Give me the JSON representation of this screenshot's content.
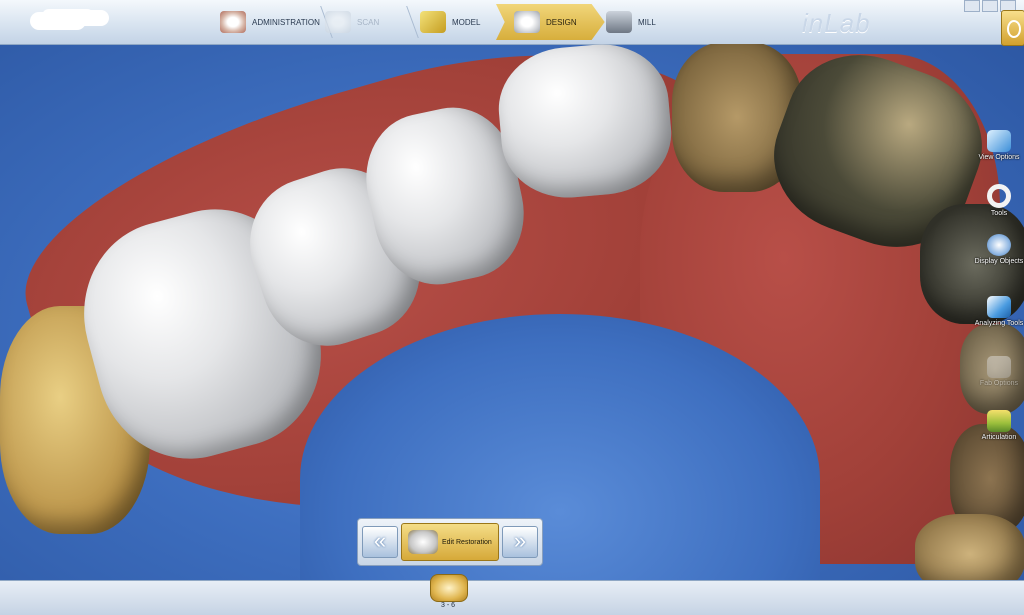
{
  "app": {
    "brand": "inLab"
  },
  "workflow": {
    "steps": [
      {
        "label": "ADMINISTRATION",
        "icon": "teeth-icon",
        "state": "done"
      },
      {
        "label": "SCAN",
        "icon": "scan-icon",
        "state": "disabled"
      },
      {
        "label": "MODEL",
        "icon": "model-icon",
        "state": "done"
      },
      {
        "label": "DESIGN",
        "icon": "design-icon",
        "state": "active"
      },
      {
        "label": "MILL",
        "icon": "mill-icon",
        "state": "pending"
      }
    ]
  },
  "right_toolbar": {
    "items": [
      {
        "label": "View Options",
        "icon": "view-options-icon"
      },
      {
        "label": "Tools",
        "icon": "tools-icon"
      },
      {
        "label": "Display Objects",
        "icon": "display-objects-icon"
      },
      {
        "label": "Analyzing Tools",
        "icon": "analyzing-tools-icon"
      },
      {
        "label": "Fab Options",
        "icon": "fab-options-icon",
        "state": "disabled"
      },
      {
        "label": "Articulation",
        "icon": "articulation-icon"
      }
    ]
  },
  "phase_nav": {
    "current": "Edit Restoration",
    "prev_symbol": "«",
    "next_symbol": "»"
  },
  "restoration": {
    "label": "3 - 6"
  },
  "colors": {
    "accent": "#d6a939",
    "background": "#3e6fc0",
    "gum": "#a24139",
    "crown": "#e5e6e8"
  }
}
